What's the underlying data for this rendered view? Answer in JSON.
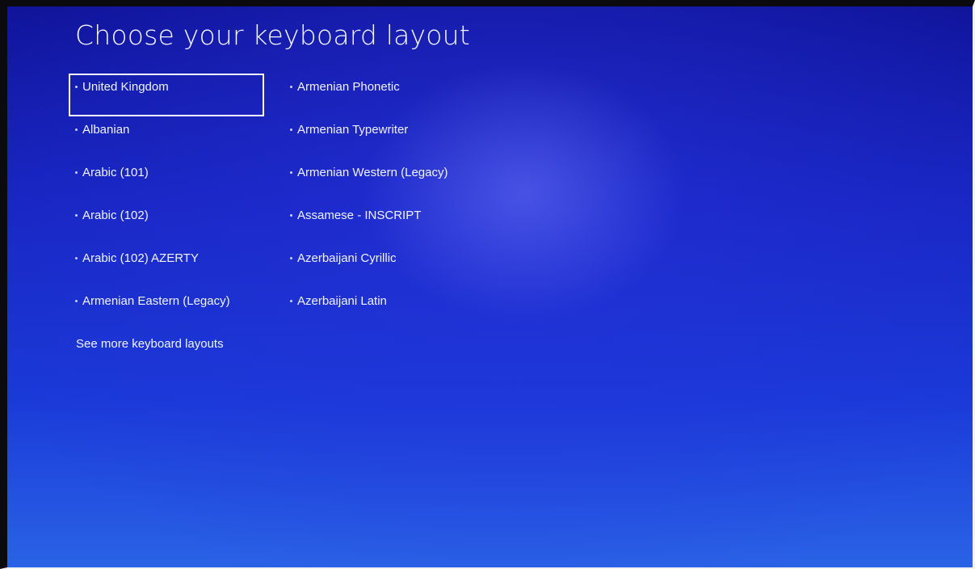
{
  "page": {
    "title": "Choose your keyboard layout",
    "more_link": "See more keyboard layouts"
  },
  "layouts": {
    "column1": [
      {
        "label": "United Kingdom",
        "selected": true
      },
      {
        "label": "Albanian"
      },
      {
        "label": "Arabic (101)"
      },
      {
        "label": "Arabic (102)"
      },
      {
        "label": "Arabic (102) AZERTY"
      },
      {
        "label": "Armenian Eastern (Legacy)"
      }
    ],
    "column2": [
      {
        "label": "Armenian Phonetic"
      },
      {
        "label": "Armenian Typewriter"
      },
      {
        "label": "Armenian Western (Legacy)"
      },
      {
        "label": "Assamese - INSCRIPT"
      },
      {
        "label": "Azerbaijani Cyrillic"
      },
      {
        "label": "Azerbaijani Latin"
      }
    ]
  },
  "colors": {
    "background_top": "#10149a",
    "background_bottom": "#2a63e6",
    "text": "#f0f3ff",
    "selection_border": "#ffffff"
  }
}
